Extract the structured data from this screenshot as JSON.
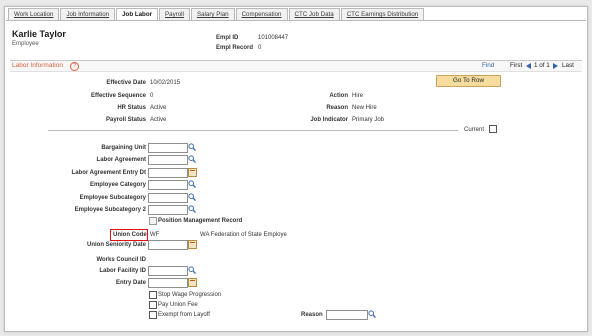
{
  "tabs": [
    {
      "label": "Work Location",
      "active": false
    },
    {
      "label": "Job Information",
      "active": false
    },
    {
      "label": "Job Labor",
      "active": true
    },
    {
      "label": "Payroll",
      "active": false
    },
    {
      "label": "Salary Plan",
      "active": false
    },
    {
      "label": "Compensation",
      "active": false
    },
    {
      "label": "CTC Job Data",
      "active": false
    },
    {
      "label": "CTC Earnings Distribution",
      "active": false
    }
  ],
  "employee": {
    "name": "Karlie Taylor",
    "type": "Employee",
    "empl_id_label": "Empl ID",
    "empl_id": "101008447",
    "empl_record_label": "Empl Record",
    "empl_record": "0"
  },
  "section": {
    "title": "Labor Information",
    "help": "?",
    "find": "Find",
    "first": "First",
    "pager": "1 of 1",
    "last": "Last",
    "go_to_row": "Go To Row"
  },
  "info": {
    "effective_date_label": "Effective Date",
    "effective_date": "10/02/2015",
    "effective_sequence_label": "Effective Sequence",
    "effective_sequence": "0",
    "hr_status_label": "HR Status",
    "hr_status": "Active",
    "payroll_status_label": "Payroll Status",
    "payroll_status": "Active",
    "action_label": "Action",
    "action": "Hire",
    "reason_label": "Reason",
    "reason": "New Hire",
    "job_indicator_label": "Job Indicator",
    "job_indicator": "Primary Job",
    "current_label": "Current"
  },
  "form": {
    "bargaining_unit": "Bargaining Unit",
    "labor_agreement": "Labor Agreement",
    "labor_agreement_entry_dt": "Labor Agreement Entry Dt",
    "employee_category": "Employee Category",
    "employee_subcategory": "Employee Subcategory",
    "employee_subcategory_2": "Employee Subcategory 2",
    "position_management_record": "Position Management Record",
    "union_code": "Union Code",
    "union_code_value": "WF",
    "union_code_desc": "WA Federation of State Employe",
    "union_seniority_date": "Union Seniority Date",
    "works_council_id": "Works Council ID",
    "labor_facility_id": "Labor Facility ID",
    "entry_date": "Entry Date",
    "stop_wage_progression": "Stop Wage Progression",
    "pay_union_fee": "Pay Union Fee",
    "exempt_from_layoff": "Exempt from Layoff",
    "reason_label": "Reason"
  }
}
